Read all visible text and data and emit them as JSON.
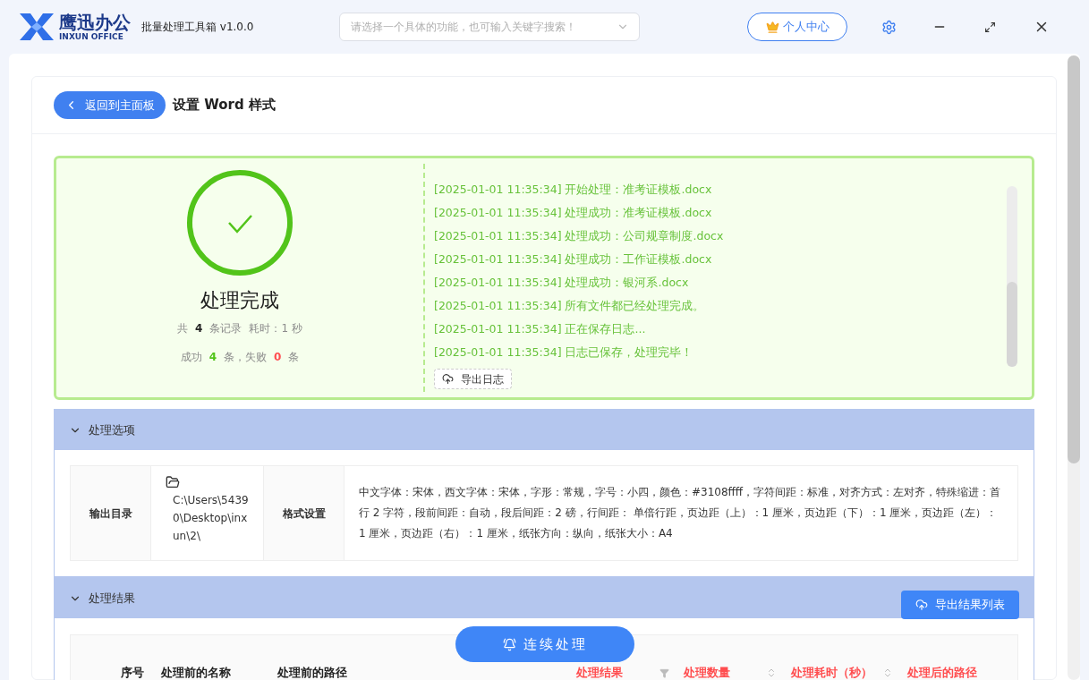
{
  "app": {
    "brand_name": "鹰迅办公",
    "brand_sub": "INXUN OFFICE",
    "title": "批量处理工具箱 v1.0.0",
    "search": {
      "placeholder": "请选择一个具体的功能，也可输入关键字搜索！"
    },
    "account_button": "个人中心"
  },
  "page": {
    "back_button": "返回到主面板",
    "title": "设置 Word 样式"
  },
  "result": {
    "status": "处理完成",
    "stats_lines": [
      [
        {
          "text": "共",
          "kind": "label"
        },
        {
          "text": "4",
          "kind": "total"
        },
        {
          "text": "条记录",
          "kind": "label"
        },
        {
          "text": "耗时：1 秒",
          "kind": "label"
        }
      ],
      [
        {
          "text": "成功",
          "kind": "label"
        },
        {
          "text": "4",
          "kind": "success"
        },
        {
          "text": "条，失败",
          "kind": "label"
        },
        {
          "text": "0",
          "kind": "failure"
        },
        {
          "text": "条",
          "kind": "label"
        }
      ]
    ],
    "log": [
      "[2025-01-01 11:35:34] 开始处理：准考证模板.docx",
      "[2025-01-01 11:35:34] 处理成功：准考证模板.docx",
      "[2025-01-01 11:35:34] 处理成功：公司规章制度.docx",
      "[2025-01-01 11:35:34] 处理成功：工作证模板.docx",
      "[2025-01-01 11:35:34] 处理成功：银河系.docx",
      "[2025-01-01 11:35:34] 所有文件都已经处理完成。",
      "[2025-01-01 11:35:34] 正在保存日志...",
      "[2025-01-01 11:35:34] 日志已保存，处理完毕！"
    ],
    "export_log_button": "导出日志"
  },
  "options": {
    "title": "处理选项",
    "expanded": true,
    "output_label": "输出目录",
    "output_path": "C:\\Users\\54390\\Desktop\\inxun\\2\\",
    "format_label": "格式设置",
    "format_value": "中文字体：宋体，西文字体：宋体，字形：常规，字号：小四，颜色：#3108ffff，字符间距：标准，对齐方式：左对齐，特殊缩进：首行 2 字符，段前间距：自动，段后间距：2 磅，行间距： 单倍行距，页边距（上）：1 厘米，页边距（下）：1 厘米，页边距（左）：1 厘米，页边距（右）：1 厘米，纸张方向：纵向，纸张大小：A4"
  },
  "results": {
    "title": "处理结果",
    "expanded": true,
    "export_button": "导出结果列表",
    "columns": [
      {
        "label": "序号",
        "kind": "plain",
        "emphasized": false
      },
      {
        "label": "处理前的名称",
        "kind": "plain",
        "emphasized": false
      },
      {
        "label": "处理前的路径",
        "kind": "plain",
        "emphasized": false
      },
      {
        "label": "处理结果",
        "kind": "filter",
        "emphasized": true
      },
      {
        "label": "处理数量",
        "kind": "sort",
        "emphasized": true
      },
      {
        "label": "处理耗时（秒）",
        "kind": "sort",
        "emphasized": true
      },
      {
        "label": "处理后的路径",
        "kind": "plain",
        "emphasized": true
      }
    ]
  },
  "continue_button": "连续处理"
}
